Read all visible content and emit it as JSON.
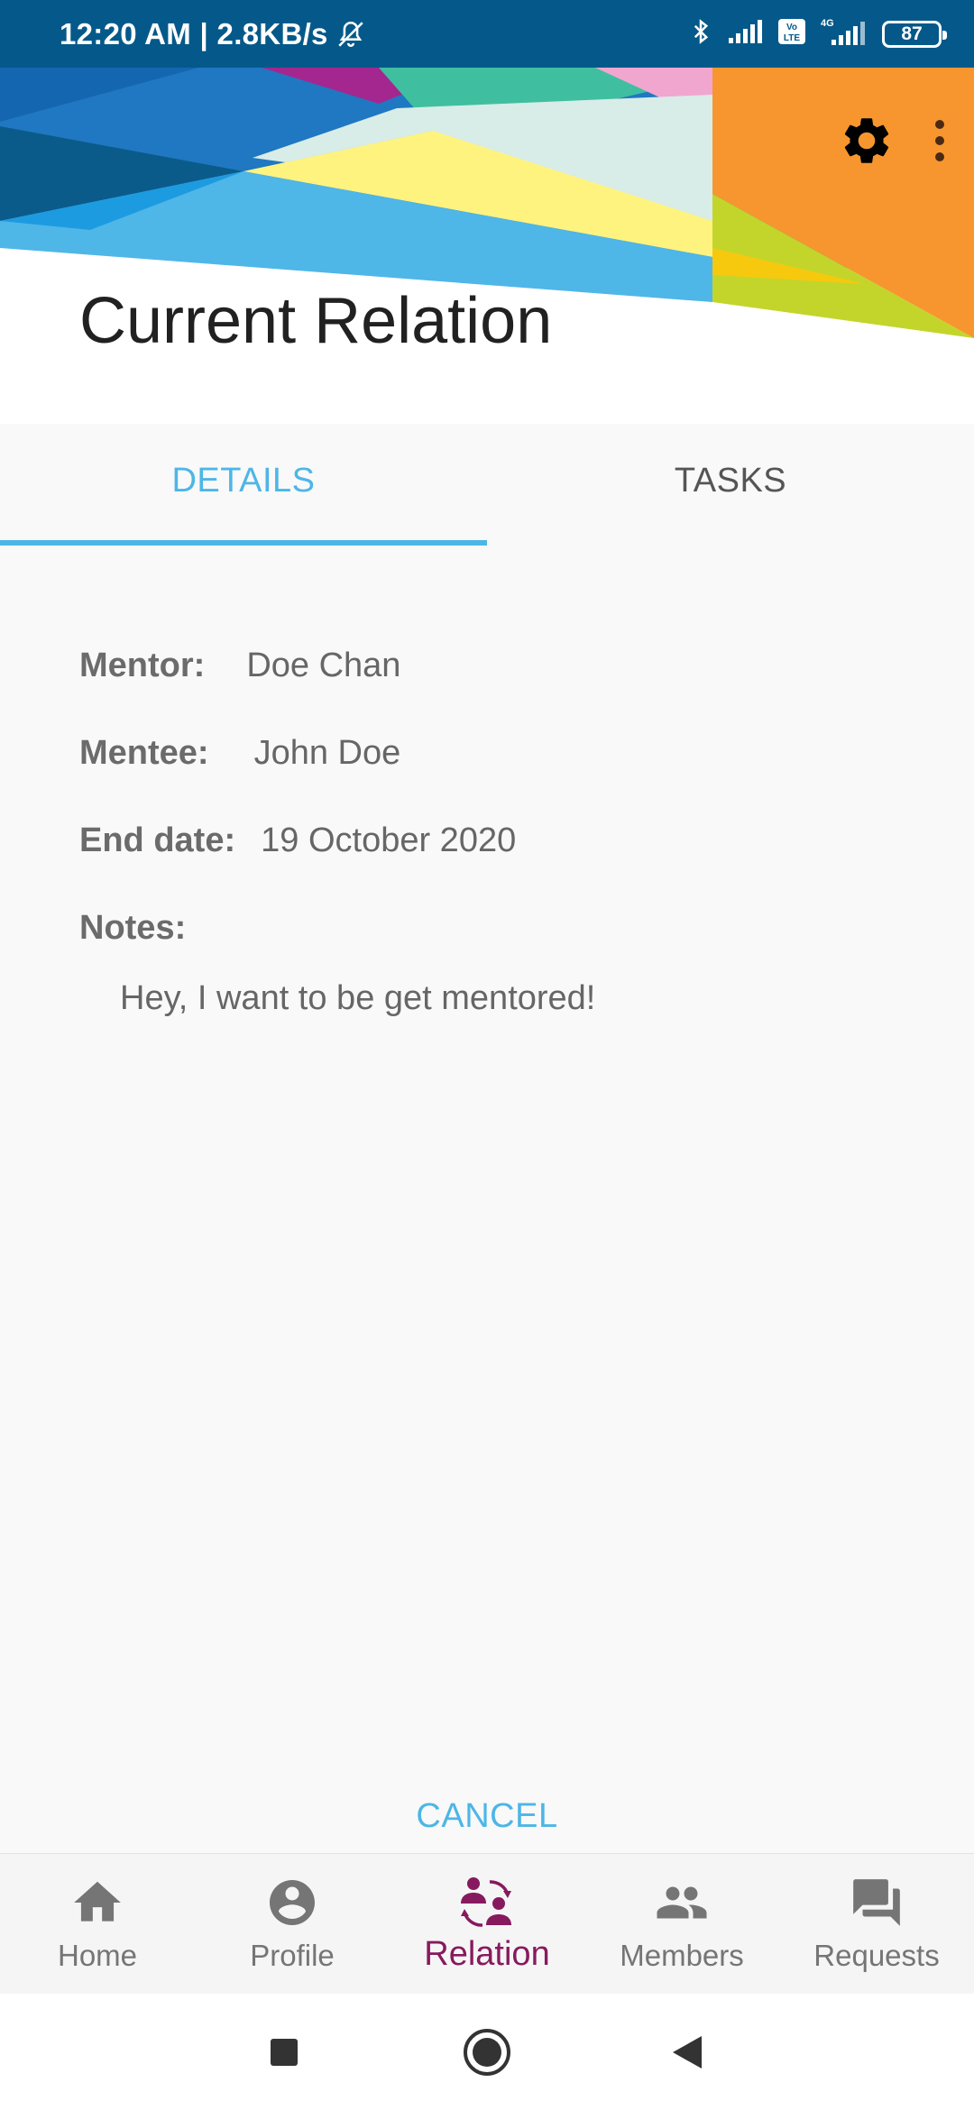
{
  "status_bar": {
    "time_speed": "12:20 AM | 2.8KB/s",
    "battery": "87",
    "icons": [
      "mute-icon",
      "bluetooth-icon",
      "signal-icon",
      "volte-icon",
      "4g-signal-icon",
      "battery-icon"
    ]
  },
  "header": {
    "title": "Current Relation",
    "actions": [
      "settings-icon",
      "more-vert-icon"
    ]
  },
  "tabs": [
    {
      "label": "DETAILS",
      "active": true
    },
    {
      "label": "TASKS",
      "active": false
    }
  ],
  "details": {
    "mentor_label": "Mentor:",
    "mentor_value": "Doe Chan",
    "mentee_label": "Mentee:",
    "mentee_value": "John Doe",
    "end_date_label": "End date:",
    "end_date_value": "19 October 2020",
    "notes_label": "Notes:",
    "notes_value": "Hey, I want to be get mentored!"
  },
  "cancel_label": "CANCEL",
  "bottom_nav": [
    {
      "label": "Home",
      "icon": "home-icon",
      "active": false
    },
    {
      "label": "Profile",
      "icon": "profile-icon",
      "active": false
    },
    {
      "label": "Relation",
      "icon": "relation-icon",
      "active": true
    },
    {
      "label": "Members",
      "icon": "members-icon",
      "active": false
    },
    {
      "label": "Requests",
      "icon": "requests-icon",
      "active": false
    }
  ],
  "colors": {
    "status_bar": "#05598a",
    "accent": "#4db6e6",
    "active_nav": "#871a5e",
    "inactive_nav": "#757575",
    "banner_orange": "#f7962e"
  },
  "system_nav": [
    "recents-icon",
    "home-circle-icon",
    "back-icon"
  ]
}
